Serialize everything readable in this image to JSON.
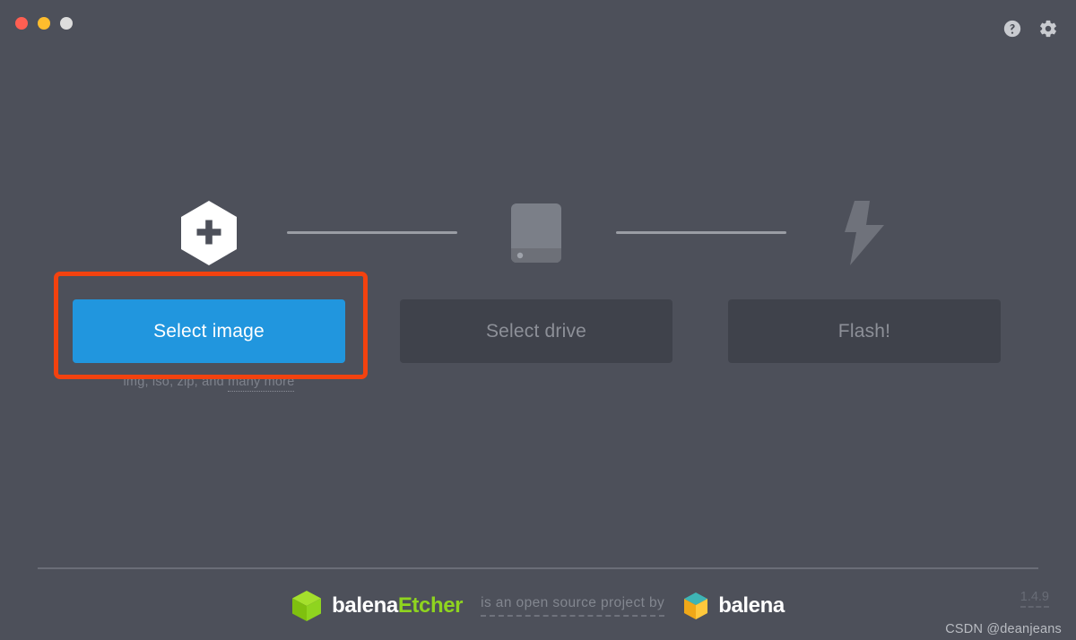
{
  "window": {
    "background_color": "#4d505a",
    "traffic_lights": [
      {
        "name": "close",
        "color": "#ff5f52"
      },
      {
        "name": "minimize",
        "color": "#ffbd2d"
      },
      {
        "name": "zoom",
        "color": "#dddddd"
      }
    ],
    "titlebar_icons": [
      {
        "name": "help-icon",
        "glyph": "question-circle"
      },
      {
        "name": "settings-icon",
        "glyph": "gear"
      }
    ]
  },
  "steps": [
    {
      "icon": "hexagon-plus-icon",
      "label": "Select image"
    },
    {
      "icon": "drive-icon",
      "label": "Select drive"
    },
    {
      "icon": "lightning-bolt-icon",
      "label": "Flash!"
    }
  ],
  "buttons": {
    "select_image": {
      "label": "Select image",
      "state": "enabled",
      "color": "#2196de",
      "text_color": "#ffffff"
    },
    "select_drive": {
      "label": "Select drive",
      "state": "disabled",
      "color": "#3f424b",
      "text_color": "#8d9098"
    },
    "flash": {
      "label": "Flash!",
      "state": "disabled",
      "color": "#3f424b",
      "text_color": "#8d9098"
    }
  },
  "hints": {
    "formats_prefix": "img, iso, zip, and ",
    "formats_link": "many more"
  },
  "annotation": {
    "target": "select-image-button",
    "color": "#f3420f"
  },
  "footer": {
    "brand_first": "balena",
    "brand_second": "Etcher",
    "brand_first_color": "#ffffff",
    "brand_second_color": "#8fd41f",
    "note": "is an open source project by",
    "company": "balena",
    "version": "1.4.9"
  },
  "watermark": {
    "text": "CSDN @deanjeans"
  }
}
